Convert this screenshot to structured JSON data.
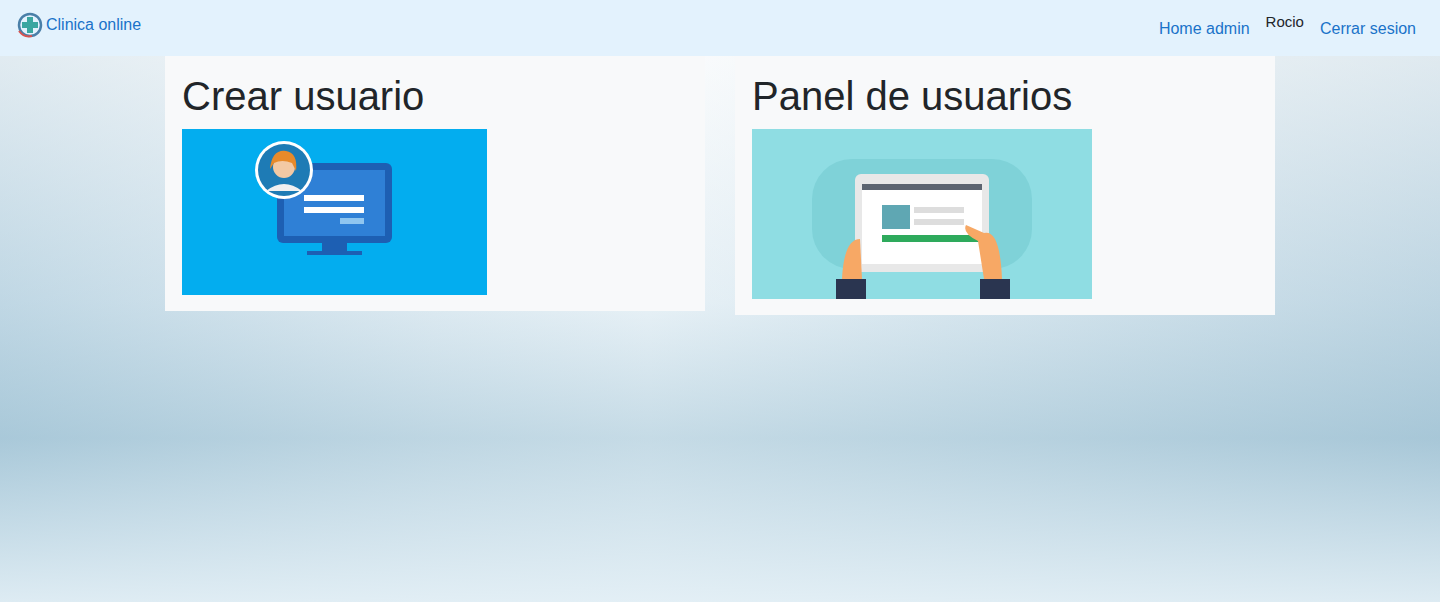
{
  "navbar": {
    "brand": "Clinica online",
    "links": [
      {
        "label": "Home admin"
      }
    ],
    "user": "Rocio",
    "logout": "Cerrar sesion"
  },
  "cards": [
    {
      "title": "Crear usuario",
      "kind": "create"
    },
    {
      "title": "Panel de usuarios",
      "kind": "panel"
    }
  ]
}
